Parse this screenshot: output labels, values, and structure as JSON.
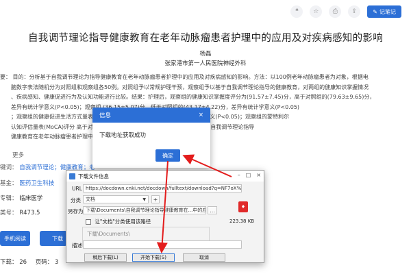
{
  "toolbar": {
    "quote_icon": "❝",
    "star_icon": "☆",
    "print_icon": "⎙",
    "share_icon": "⇪",
    "note_label": "记笔记"
  },
  "article": {
    "title": "自我调节理论指导健康教育在老年动脉瘤患者护理中的应用及对疾病感知的影响",
    "author": "杨磊",
    "org": "张家港市第一人民医院神经外科",
    "abstract_lines": [
      "要：  目的：分析基于自我调节理论为指导健康教育在老年动脉瘤患者护理中的应用及对疾病感知的影响。方法：以100例老年动脉瘤患者为对象，根据电",
      "脑数字表法随机分为对照组和观察组各50例。对照组予以常规护理干预，观察组予以基于自我调节理论指导的健康教育，对两组的健康知识掌握情况",
      "、疾病感知、健康促进行为及认知功能进行比较。结果：护理后，观察组的健康知识掌握度评分为(91.57±7.45)分，高于对照组的(79.63±9.65)分，",
      "差异有统计学意义(P<0.05)；观察组              (36.15±5.07)分，低于对照组的(43.17±4.22)分，差异有统计学意义(P<0.05)",
      "；观察组的健康促进生活方式量表              对照组的(109.01±22.04)分，差异有统计学意义(P<0.05)；观察组的蒙特利尔",
      "认知评估量表(MoCA)评分              高于对照组，差异有统计学意义(P<0.05)。结论：基于自我调节理论指导",
      "健康教育在老年动脉瘤患者护理中"
    ],
    "more": "更多",
    "keywords_label": "键词：",
    "keywords_value": "自我调节理论；健康教育；老",
    "fund_label": "基金：",
    "fund_value": "医药卫生科技",
    "category_label": "专辑：",
    "category_value": "临床医学",
    "clc_label": "类号：",
    "clc_value": "R473.5",
    "btn_html": "手机阅读",
    "btn_other": "下载",
    "downloads_label": "下载：",
    "downloads_value": "26",
    "pages_label": "页码：",
    "pages_value": "3"
  },
  "modal": {
    "title": "信息",
    "close_icon": "×",
    "message": "下载地址获取成功",
    "ok_label": "确定"
  },
  "download_dialog": {
    "title": "下载文件信息",
    "minimize": "–",
    "maximize": "□",
    "close": "×",
    "url_label": "URL",
    "url_value": "https://docdown.cnki.net/docdown/fulltext/download?q=NF7oX%2BL06j8",
    "category_label": "分类",
    "category_value": "文档",
    "add_button": "+",
    "saveas_label": "另存为",
    "saveas_value": "下载\\Documents\\自我调节理论指导健康教育在...中的应用及",
    "folder_button": "…",
    "remember_label": "让\"文档\"分类使用该路径",
    "path_hint": "下载\\Documents\\",
    "file_size": "223.38  KB",
    "desc_label": "描述",
    "desc_value": "",
    "later_button": "稍后下载(L)",
    "start_button": "开始下载(S)",
    "cancel_button": "取消"
  },
  "colors": {
    "accent": "#2c6fd6",
    "arrow": "#e31c1c"
  }
}
